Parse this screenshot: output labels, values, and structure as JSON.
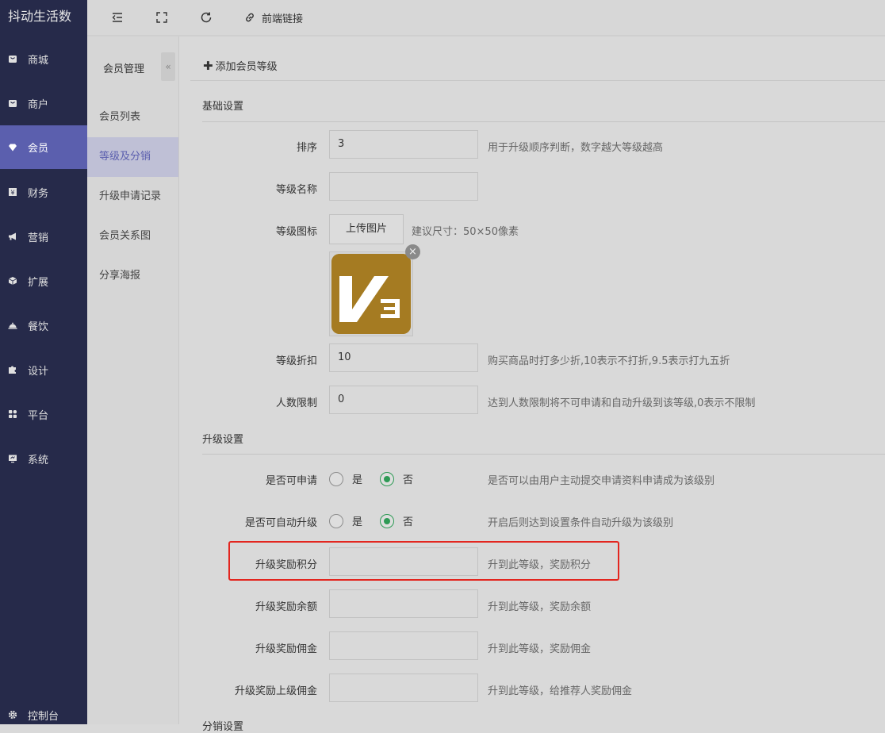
{
  "sidebar": {
    "brand": "抖动生活数",
    "items": [
      {
        "label": "商城",
        "icon": "shop-icon"
      },
      {
        "label": "商户",
        "icon": "merchant-icon"
      },
      {
        "label": "会员",
        "icon": "diamond-icon"
      },
      {
        "label": "财务",
        "icon": "finance-icon"
      },
      {
        "label": "营销",
        "icon": "megaphone-icon"
      },
      {
        "label": "扩展",
        "icon": "cube-icon"
      },
      {
        "label": "餐饮",
        "icon": "dish-cover-icon"
      },
      {
        "label": "设计",
        "icon": "puzzle-icon"
      },
      {
        "label": "平台",
        "icon": "grid-icon"
      },
      {
        "label": "系统",
        "icon": "monitor-icon"
      }
    ],
    "active": "会员",
    "console_label": "控制台"
  },
  "topbar": {
    "frontend_link_label": "前端链接"
  },
  "subnav": {
    "title": "会员管理",
    "collapse_symbol": "«",
    "items": [
      "会员列表",
      "等级及分销",
      "升级申请记录",
      "会员关系图",
      "分享海报"
    ],
    "active": "等级及分销"
  },
  "content": {
    "add_level_label": "添加会员等级",
    "basic_section": "基础设置",
    "sort_label": "排序",
    "sort_value": "3",
    "sort_hint": "用于升级顺序判断，数字越大等级越高",
    "name_label": "等级名称",
    "name_value": "",
    "icon_label": "等级图标",
    "upload_label": "上传图片",
    "upload_hint": "建议尺寸：50×50像素",
    "remove_symbol": "×",
    "discount_label": "等级折扣",
    "discount_value": "10",
    "discount_hint": "购买商品时打多少折,10表示不打折,9.5表示打九五折",
    "limit_label": "人数限制",
    "limit_value": "0",
    "limit_hint": "达到人数限制将不可申请和自动升级到该等级,0表示不限制",
    "upgrade_section": "升级设置",
    "apply_label": "是否可申请",
    "apply_yes": "是",
    "apply_no": "否",
    "apply_selected": "否",
    "apply_hint": "是否可以由用户主动提交申请资料申请成为该级别",
    "auto_label": "是否可自动升级",
    "auto_yes": "是",
    "auto_no": "否",
    "auto_selected": "否",
    "auto_hint": "开启后则达到设置条件自动升级为该级别",
    "points_label": "升级奖励积分",
    "points_value": "",
    "points_hint": "升到此等级，奖励积分",
    "balance_label": "升级奖励余额",
    "balance_value": "",
    "balance_hint": "升到此等级，奖励余额",
    "commission_label": "升级奖励佣金",
    "commission_value": "",
    "commission_hint": "升到此等级，奖励佣金",
    "parent_commission_label": "升级奖励上级佣金",
    "parent_commission_value": "",
    "parent_commission_hint": "升到此等级，给推荐人奖励佣金",
    "distribution_section": "分销设置"
  },
  "colors": {
    "sidebar_bg": "#262a4a",
    "active_purple": "#5b5fae",
    "radio_green": "#2e9a55",
    "highlight_red": "#e3261f"
  }
}
